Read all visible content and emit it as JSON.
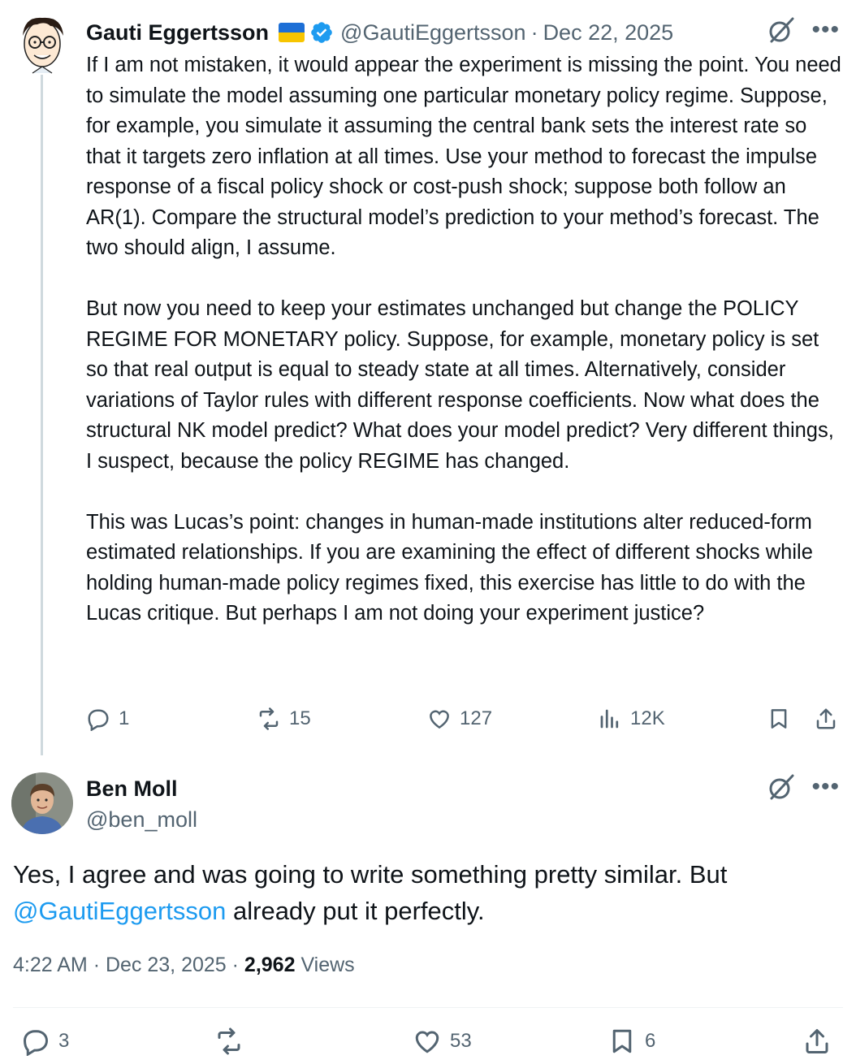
{
  "reply": {
    "author_name": "Gauti Eggertsson",
    "handle": "@GautiEggertsson",
    "separator": "·",
    "date": "Dec 22, 2025",
    "paragraphs": [
      "If I am not mistaken, it would appear the experiment is missing the point. You need to simulate the model assuming one particular monetary policy regime. Suppose, for example, you simulate it assuming the central bank sets the interest rate so that it targets zero inflation at all times. Use your method to forecast the impulse response of a fiscal policy shock or cost-push shock; suppose both follow an AR(1). Compare the structural model’s prediction to your method’s forecast. The two should align, I assume.",
      "But now you need to keep your estimates unchanged but change the POLICY REGIME FOR MONETARY policy. Suppose, for example, monetary policy is set so that real output is equal to steady state at all times. Alternatively, consider variations of Taylor rules with different response coefficients. Now what does the structural NK model predict? What does your model predict? Very different things, I suspect, because the policy REGIME has changed.",
      "This was Lucas’s point: changes in human-made institutions alter reduced-form estimated relationships. If you are examining the effect of different shocks while holding human-made policy regimes fixed, this exercise has little to do with the Lucas critique. But perhaps I am not doing your experiment justice?"
    ],
    "stats": {
      "replies": "1",
      "reposts": "15",
      "likes": "127",
      "views": "12K"
    },
    "icons": [
      "flag-icon",
      "verified-badge-icon",
      "grok-icon",
      "more-icon",
      "reply-icon",
      "repost-icon",
      "like-icon",
      "views-icon",
      "bookmark-icon",
      "share-icon"
    ]
  },
  "post": {
    "author_name": "Ben Moll",
    "handle": "@ben_moll",
    "text_before": "Yes, I agree and was going to write something pretty similar. But ",
    "mention": "@GautiEggertsson",
    "text_after": " already put it perfectly.",
    "time": "4:22 AM",
    "separator": "·",
    "date": "Dec 23, 2025",
    "views_count": "2,962",
    "views_label": "Views",
    "stats": {
      "replies": "3",
      "likes": "53",
      "bookmarks": "6"
    }
  },
  "colors": {
    "text": "#0f1419",
    "secondary": "#536471",
    "accent": "#1d9bf0",
    "thread_line": "#cfd9de"
  }
}
